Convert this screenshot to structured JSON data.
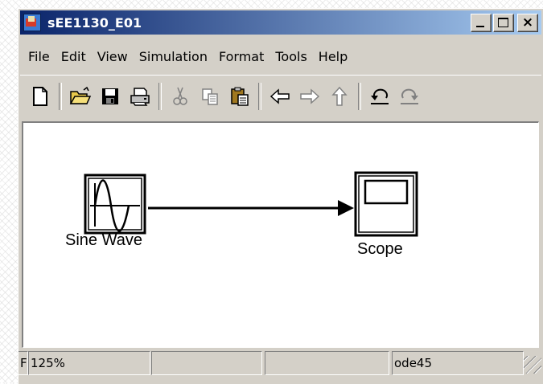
{
  "window": {
    "title": "sEE1130_E01",
    "caption_buttons": [
      "minimize",
      "maximize",
      "close"
    ],
    "close_glyph": "×"
  },
  "menu": [
    "File",
    "Edit",
    "View",
    "Simulation",
    "Format",
    "Tools",
    "Help"
  ],
  "toolbar": {
    "icons": [
      "new-icon",
      "open-icon",
      "save-icon",
      "print-icon",
      "cut-icon",
      "copy-icon",
      "paste-icon",
      "back-icon",
      "forward-icon",
      "up-icon",
      "undo-icon",
      "redo-icon"
    ]
  },
  "model": {
    "blocks": [
      {
        "name": "Sine Wave",
        "type": "source"
      },
      {
        "name": "Scope",
        "type": "sink"
      }
    ],
    "connection": {
      "from": "Sine Wave",
      "to": "Scope"
    }
  },
  "status": {
    "ready": "F",
    "zoom": "125%",
    "field2": "",
    "field3": "",
    "solver": "ode45"
  }
}
